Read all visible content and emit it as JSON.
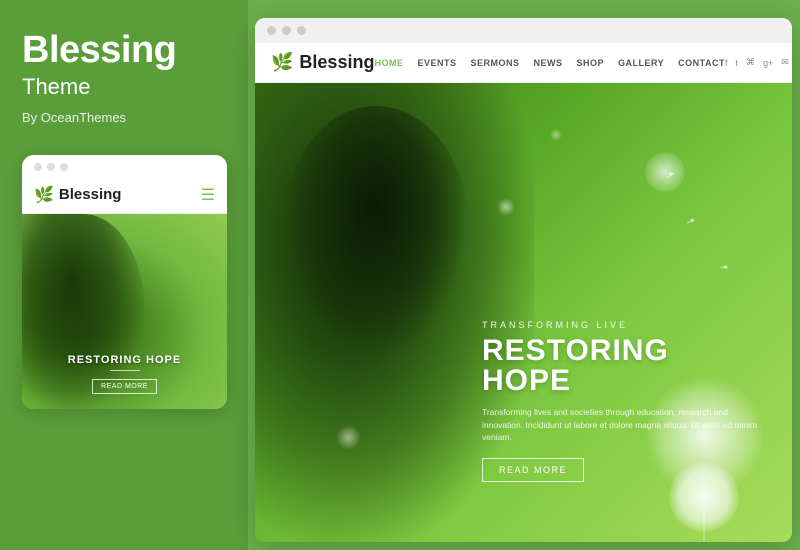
{
  "left": {
    "title": "Blessing",
    "subtitle": "Theme",
    "by": "By OceanThemes"
  },
  "mobile": {
    "logo": "Blessing",
    "nav_dots": [
      "dot1",
      "dot2",
      "dot3"
    ],
    "hero_overline": "RESTORING HOPE",
    "hero_btn": "READ MORE"
  },
  "desktop": {
    "logo": "Blessing",
    "nav_links": [
      "HOME",
      "EVENTS",
      "SERMONS",
      "NEWS",
      "SHOP",
      "GALLERY",
      "CONTACT"
    ],
    "social_icons": [
      "f",
      "t",
      "rss",
      "g+",
      "mail"
    ],
    "hero_overline": "TRANSFORMING LIVE",
    "hero_title": "RESTORING HOPE",
    "hero_desc": "Transforming lives and societies through education, research and innovation. Incididunt ut labore et dolore magna aliqua. Ut enim ad minim veniam.",
    "hero_btn": "READ MORE",
    "window_dots": [
      "d1",
      "d2",
      "d3"
    ]
  }
}
